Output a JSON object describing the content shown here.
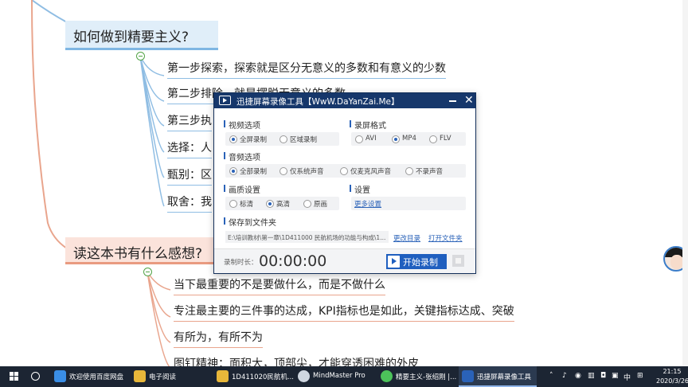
{
  "mindmap": {
    "topic1": "如何做到精要主义?",
    "topic1_items": [
      "第一步探索，探索就是区分无意义的多数和有意义的少数",
      "第二步排除，就是摆脱无意义的多数",
      "第三步执",
      "选择：人",
      "甄别：区",
      "取舍：我"
    ],
    "topic2": "读这本书有什么感想?",
    "topic2_items": [
      "当下最重要的不是要做什么，而是不做什么",
      "专注最主要的三件事的达成，KPI指标也是如此，关键指标达成、突破",
      "有所为，有所不为",
      "图钉精神：面积大，顶部尖，才能穿透困难的外皮"
    ]
  },
  "recorder": {
    "title": "迅捷屏幕录像工具【WwW.DaYanZai.Me】",
    "video_section": "视频选项",
    "video_options": [
      "全屏录制",
      "区域录制"
    ],
    "video_selected": "全屏录制",
    "format_section": "录屏格式",
    "format_options": [
      "AVI",
      "MP4",
      "FLV"
    ],
    "format_selected": "MP4",
    "audio_section": "音频选项",
    "audio_options": [
      "全部录制",
      "仅系统声音",
      "仅麦克风声音",
      "不录声音"
    ],
    "audio_selected": "全部录制",
    "quality_section": "画质设置",
    "quality_options": [
      "标清",
      "高清",
      "原画"
    ],
    "quality_selected": "高清",
    "settings_section": "设置",
    "more_settings": "更多设置",
    "save_section": "保存到文件夹",
    "save_path": "E:\\培训教材\\第一章\\1D411000 民航机场的功能与构成\\1...",
    "change_dir": "更改目录",
    "open_folder": "打开文件夹",
    "record_time_label": "录制时长：",
    "timer": "00:00:00",
    "start_label": "开始录制"
  },
  "taskbar": {
    "items": [
      {
        "label": "欢迎使用百度网盘",
        "icon": "baidu-netdisk-icon",
        "color": "#3a8ee6"
      },
      {
        "label": "电子阅读",
        "icon": "folder-icon",
        "color": "#e8b73a"
      },
      {
        "label": "1D411020民航机...",
        "icon": "folder-icon",
        "color": "#e8b73a"
      },
      {
        "label": "MindMaster Pro",
        "icon": "mindmaster-icon",
        "color": "#cfd6e0"
      },
      {
        "label": "精要主义-张绍刚 |...",
        "icon": "wechat-icon",
        "color": "#4cc35a"
      },
      {
        "label": "迅捷屏幕录像工具",
        "icon": "screen-recorder-icon",
        "color": "#2a62b8"
      }
    ],
    "ime": "中",
    "time": "21:15",
    "date": "2020/3/26"
  }
}
